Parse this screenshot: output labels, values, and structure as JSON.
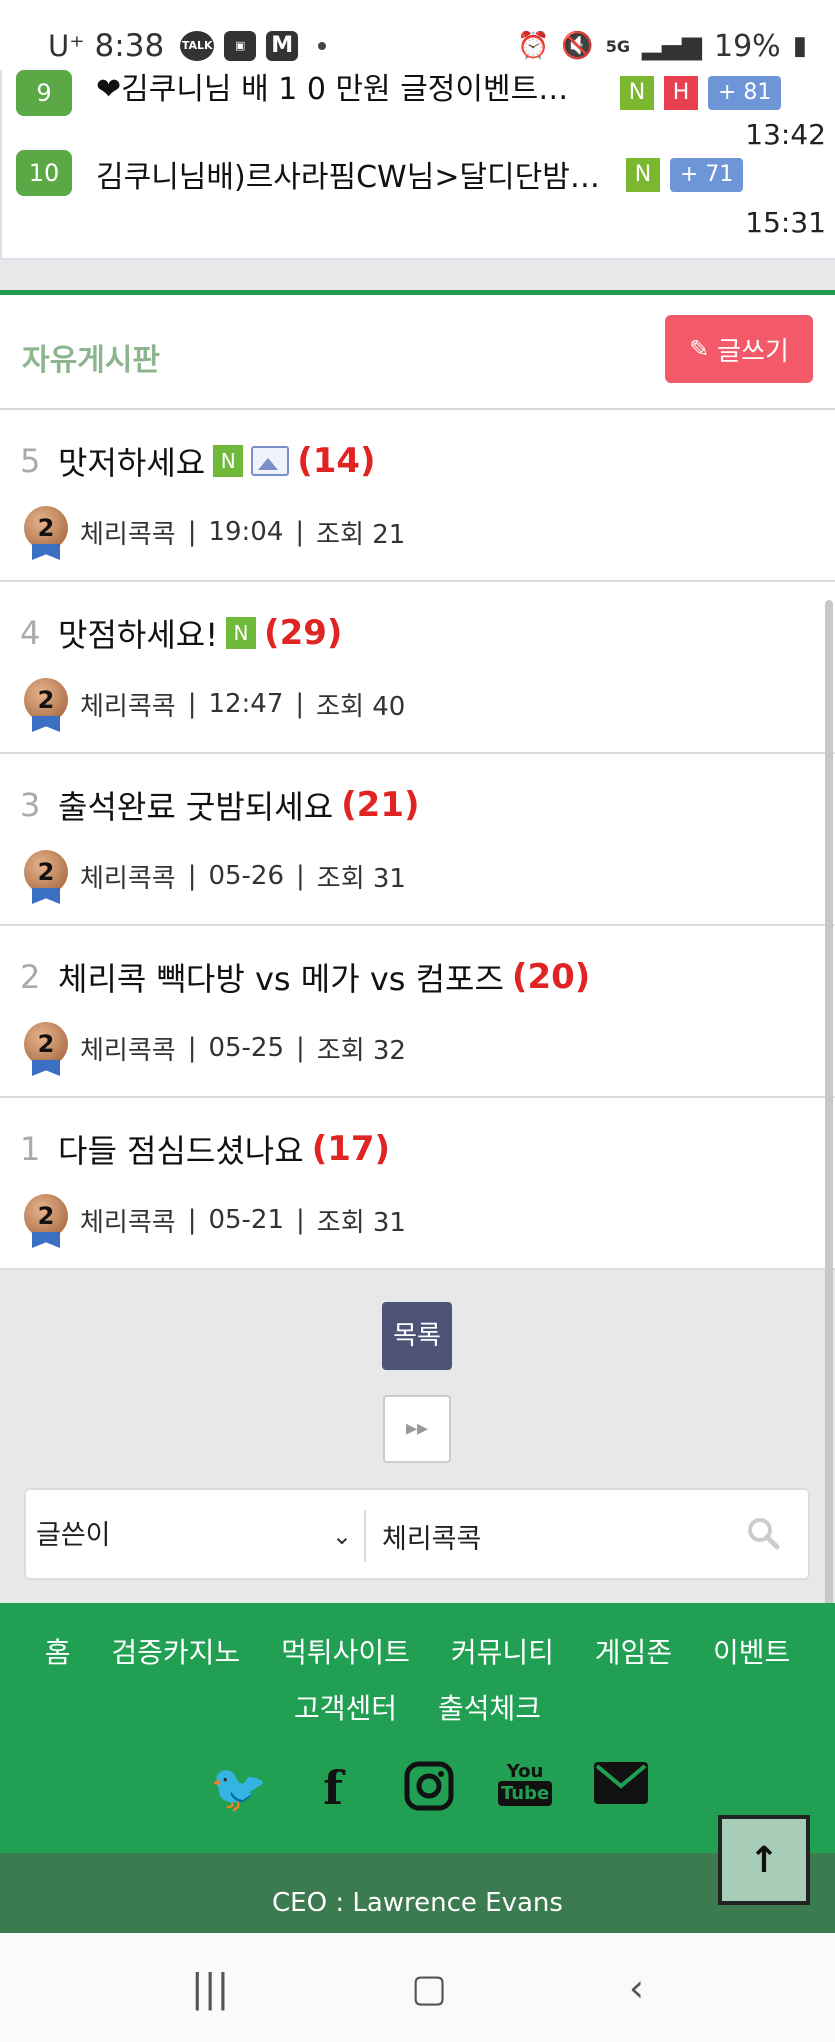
{
  "status_bar": {
    "carrier": "U⁺",
    "time": "8:38",
    "battery": "19%",
    "network": "5G"
  },
  "top_list": [
    {
      "num": "9",
      "title": "❤김쿠니님 배 1 0 만원 글정이벤트…",
      "badges": [
        "N",
        "H"
      ],
      "plus": "+ 81",
      "time": "13:42"
    },
    {
      "num": "10",
      "title": "김쿠니님배)르사라핌CW님>달디단밤…",
      "badges": [
        "N"
      ],
      "plus": "+ 71",
      "time": "15:31"
    }
  ],
  "board": {
    "title": "자유게시판",
    "write_label": "글쓰기",
    "posts": [
      {
        "num": "5",
        "title": "맛저하세요",
        "new": "N",
        "has_image": true,
        "count": "(14)",
        "author": "체리콕콕",
        "time": "19:04",
        "views": "조회 21",
        "rank": "2"
      },
      {
        "num": "4",
        "title": "맛점하세요!",
        "new": "N",
        "has_image": false,
        "count": "(29)",
        "author": "체리콕콕",
        "time": "12:47",
        "views": "조회 40",
        "rank": "2"
      },
      {
        "num": "3",
        "title": "출석완료 굿밤되세요",
        "new": "",
        "has_image": false,
        "count": "(21)",
        "author": "체리콕콕",
        "time": "05-26",
        "views": "조회 31",
        "rank": "2"
      },
      {
        "num": "2",
        "title": "체리콕 빽다방 vs 메가 vs 컴포즈",
        "new": "",
        "has_image": false,
        "count": "(20)",
        "author": "체리콕콕",
        "time": "05-25",
        "views": "조회 32",
        "rank": "2"
      },
      {
        "num": "1",
        "title": "다들 점심드셨나요",
        "new": "",
        "has_image": false,
        "count": "(17)",
        "author": "체리콕콕",
        "time": "05-21",
        "views": "조회 31",
        "rank": "2"
      }
    ],
    "list_label": "목록",
    "next_label": "▸▸"
  },
  "search": {
    "field_selected": "글쓴이",
    "value": "체리콕콕"
  },
  "footer": {
    "nav_row1": [
      "홈",
      "검증카지노",
      "먹튀사이트",
      "커뮤니티",
      "게임존",
      "이벤트"
    ],
    "nav_row2": [
      "고객센터",
      "출석체크"
    ],
    "ceo": "CEO : Lawrence Evans"
  },
  "colors": {
    "brand_green": "#21a053",
    "write_button": "#f25a6a",
    "comment_count": "#e02424",
    "list_button": "#4d5478"
  }
}
